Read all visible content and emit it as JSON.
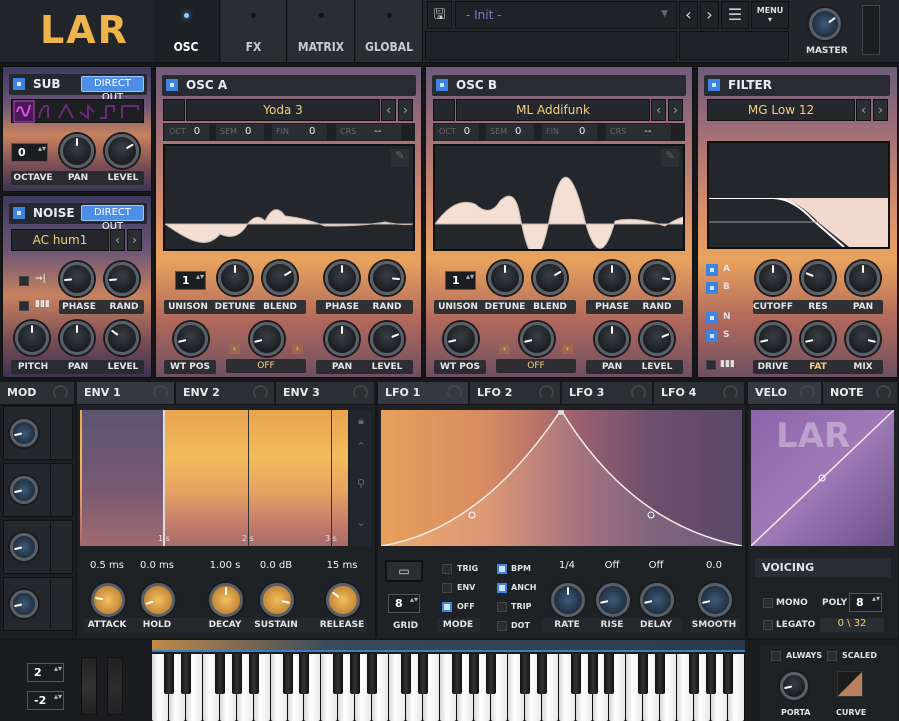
{
  "header": {
    "logo": "LAR",
    "tabs": [
      {
        "label": "OSC",
        "active": true
      },
      {
        "label": "FX"
      },
      {
        "label": "MATRIX"
      },
      {
        "label": "GLOBAL"
      }
    ],
    "preset": "- Init -",
    "menu": "MENU",
    "master_label": "MASTER",
    "master_value": 0.7
  },
  "sub": {
    "title": "SUB",
    "direct_out": "DIRECT OUT",
    "waveforms": [
      "sine",
      "rounded",
      "triangle",
      "saw",
      "square",
      "pulse"
    ],
    "selected_waveform": "sine",
    "octave": "0",
    "labels": [
      "OCTAVE",
      "PAN",
      "LEVEL"
    ],
    "knobs": {
      "pan": 0.5,
      "level": 0.72
    }
  },
  "noise": {
    "title": "NOISE",
    "direct_out": "DIRECT OUT",
    "preset": "AC hum1",
    "labels_top": [
      "PHASE",
      "RAND"
    ],
    "labels_bottom": [
      "PITCH",
      "PAN",
      "LEVEL"
    ],
    "knobs": {
      "phase": 0.15,
      "rand": 0.15,
      "pitch": 0.5,
      "pan": 0.5,
      "level": 0.3
    }
  },
  "osc_a": {
    "title": "OSC A",
    "preset": "Yoda 3",
    "oct_label": "OCT",
    "oct": "0",
    "sem_label": "SEM",
    "sem": "0",
    "fin_label": "FIN",
    "fin": "0",
    "crs_label": "CRS",
    "crs": "--",
    "unison": "1",
    "labels_top": [
      "UNISON",
      "DETUNE",
      "BLEND",
      "PHASE",
      "RAND"
    ],
    "labels_bottom": [
      "WT POS",
      "OFF",
      "PAN",
      "LEVEL"
    ],
    "knobs": {
      "detune": 0.5,
      "blend": 0.72,
      "phase": 0.5,
      "rand": 0.85,
      "wtpos": 0.12,
      "warp": 0.12,
      "pan": 0.5,
      "level": 0.75
    }
  },
  "osc_b": {
    "title": "OSC B",
    "preset": "ML Addifunk",
    "oct_label": "OCT",
    "oct": "0",
    "sem_label": "SEM",
    "sem": "0",
    "fin_label": "FIN",
    "fin": "0",
    "crs_label": "CRS",
    "crs": "--",
    "unison": "1",
    "labels_top": [
      "UNISON",
      "DETUNE",
      "BLEND",
      "PHASE",
      "RAND"
    ],
    "labels_bottom": [
      "WT POS",
      "OFF",
      "PAN",
      "LEVEL"
    ],
    "knobs": {
      "detune": 0.5,
      "blend": 0.72,
      "phase": 0.5,
      "rand": 0.85,
      "wtpos": 0.12,
      "warp": 0.12,
      "pan": 0.5,
      "level": 0.75
    }
  },
  "filter": {
    "title": "FILTER",
    "preset": "MG Low 12",
    "routes": [
      "A",
      "B",
      "N",
      "S"
    ],
    "labels_top": [
      "CUTOFF",
      "RES",
      "PAN"
    ],
    "labels_bottom": [
      "DRIVE",
      "FAT",
      "MIX"
    ],
    "knobs": {
      "cutoff": 0.5,
      "res": 0.25,
      "pan": 0.5,
      "drive": 0.12,
      "fat": 0.12,
      "mix": 0.88
    }
  },
  "mod": {
    "title": "MOD",
    "knobs": [
      0.12,
      0.12,
      0.12,
      0.12
    ]
  },
  "env": {
    "tabs": [
      "ENV 1",
      "ENV 2",
      "ENV 3"
    ],
    "time_ticks": [
      "1 s",
      "2 s",
      "3 s"
    ],
    "values": [
      "0.5 ms",
      "0.0 ms",
      "1.00 s",
      "0.0 dB",
      "15 ms"
    ],
    "labels": [
      "ATTACK",
      "HOLD",
      "DECAY",
      "SUSTAIN",
      "RELEASE"
    ],
    "knobs": [
      0.2,
      0.1,
      0.5,
      0.88,
      0.3
    ]
  },
  "lfo": {
    "tabs": [
      "LFO 1",
      "LFO 2",
      "LFO 3",
      "LFO 4"
    ],
    "grid": "8",
    "grid_label": "GRID",
    "mode_label": "MODE",
    "modes": [
      {
        "label": "TRIG",
        "on": false
      },
      {
        "label": "ENV",
        "on": false
      },
      {
        "label": "OFF",
        "on": true
      }
    ],
    "options": [
      {
        "label": "BPM",
        "on": true
      },
      {
        "label": "ANCH",
        "on": true
      },
      {
        "label": "TRIP",
        "on": false
      },
      {
        "label": "DOT",
        "on": false
      }
    ],
    "values": [
      "1/4",
      "Off",
      "Off",
      "0.0"
    ],
    "labels": [
      "RATE",
      "RISE",
      "DELAY",
      "SMOOTH"
    ],
    "knobs": [
      0.5,
      0.12,
      0.12,
      0.12
    ]
  },
  "velo": {
    "tabs": [
      "VELO",
      "NOTE"
    ],
    "voicing": "VOICING",
    "mono": "MONO",
    "legato": "LEGATO",
    "poly_label": "POLY",
    "poly": "8",
    "voices": "0",
    "voices_max": "\\ 32"
  },
  "keyboard": {
    "pitch_up": "2",
    "pitch_down": "-2",
    "always": "ALWAYS",
    "scaled": "SCALED",
    "porta": "PORTA",
    "curve": "CURVE",
    "porta_value": 0.12
  },
  "colors": {
    "accent": "#3d84e0",
    "preset_text": "#f3cf83",
    "logo": "#f0b44c"
  }
}
